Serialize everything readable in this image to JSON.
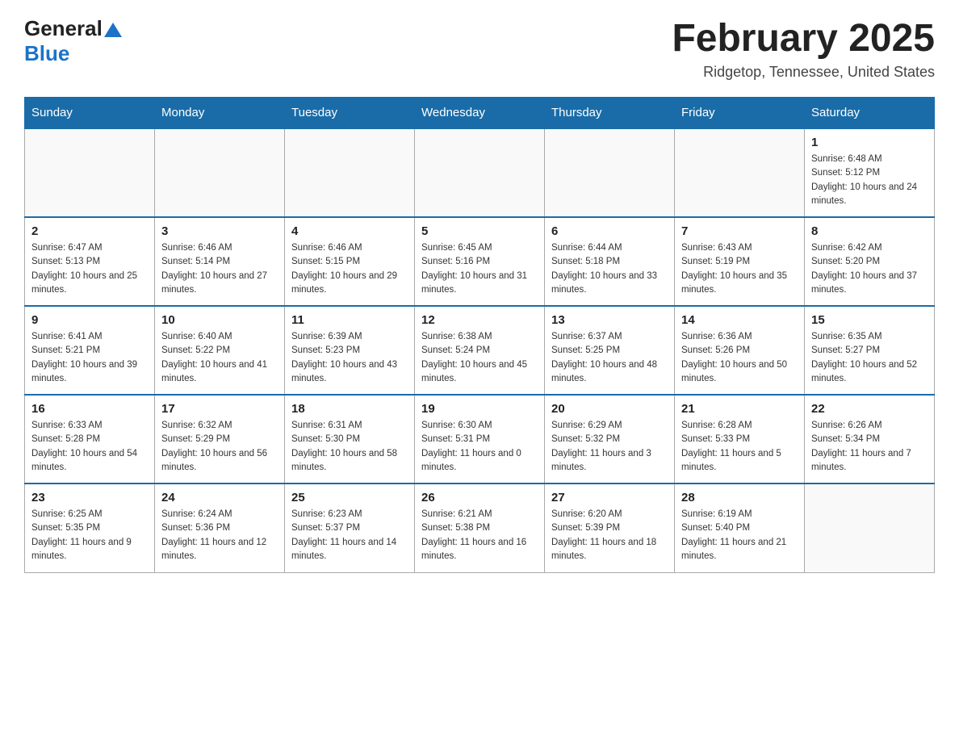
{
  "header": {
    "logo_general": "General",
    "logo_blue": "Blue",
    "title": "February 2025",
    "location": "Ridgetop, Tennessee, United States"
  },
  "weekdays": [
    "Sunday",
    "Monday",
    "Tuesday",
    "Wednesday",
    "Thursday",
    "Friday",
    "Saturday"
  ],
  "weeks": [
    [
      {
        "day": "",
        "info": ""
      },
      {
        "day": "",
        "info": ""
      },
      {
        "day": "",
        "info": ""
      },
      {
        "day": "",
        "info": ""
      },
      {
        "day": "",
        "info": ""
      },
      {
        "day": "",
        "info": ""
      },
      {
        "day": "1",
        "info": "Sunrise: 6:48 AM\nSunset: 5:12 PM\nDaylight: 10 hours and 24 minutes."
      }
    ],
    [
      {
        "day": "2",
        "info": "Sunrise: 6:47 AM\nSunset: 5:13 PM\nDaylight: 10 hours and 25 minutes."
      },
      {
        "day": "3",
        "info": "Sunrise: 6:46 AM\nSunset: 5:14 PM\nDaylight: 10 hours and 27 minutes."
      },
      {
        "day": "4",
        "info": "Sunrise: 6:46 AM\nSunset: 5:15 PM\nDaylight: 10 hours and 29 minutes."
      },
      {
        "day": "5",
        "info": "Sunrise: 6:45 AM\nSunset: 5:16 PM\nDaylight: 10 hours and 31 minutes."
      },
      {
        "day": "6",
        "info": "Sunrise: 6:44 AM\nSunset: 5:18 PM\nDaylight: 10 hours and 33 minutes."
      },
      {
        "day": "7",
        "info": "Sunrise: 6:43 AM\nSunset: 5:19 PM\nDaylight: 10 hours and 35 minutes."
      },
      {
        "day": "8",
        "info": "Sunrise: 6:42 AM\nSunset: 5:20 PM\nDaylight: 10 hours and 37 minutes."
      }
    ],
    [
      {
        "day": "9",
        "info": "Sunrise: 6:41 AM\nSunset: 5:21 PM\nDaylight: 10 hours and 39 minutes."
      },
      {
        "day": "10",
        "info": "Sunrise: 6:40 AM\nSunset: 5:22 PM\nDaylight: 10 hours and 41 minutes."
      },
      {
        "day": "11",
        "info": "Sunrise: 6:39 AM\nSunset: 5:23 PM\nDaylight: 10 hours and 43 minutes."
      },
      {
        "day": "12",
        "info": "Sunrise: 6:38 AM\nSunset: 5:24 PM\nDaylight: 10 hours and 45 minutes."
      },
      {
        "day": "13",
        "info": "Sunrise: 6:37 AM\nSunset: 5:25 PM\nDaylight: 10 hours and 48 minutes."
      },
      {
        "day": "14",
        "info": "Sunrise: 6:36 AM\nSunset: 5:26 PM\nDaylight: 10 hours and 50 minutes."
      },
      {
        "day": "15",
        "info": "Sunrise: 6:35 AM\nSunset: 5:27 PM\nDaylight: 10 hours and 52 minutes."
      }
    ],
    [
      {
        "day": "16",
        "info": "Sunrise: 6:33 AM\nSunset: 5:28 PM\nDaylight: 10 hours and 54 minutes."
      },
      {
        "day": "17",
        "info": "Sunrise: 6:32 AM\nSunset: 5:29 PM\nDaylight: 10 hours and 56 minutes."
      },
      {
        "day": "18",
        "info": "Sunrise: 6:31 AM\nSunset: 5:30 PM\nDaylight: 10 hours and 58 minutes."
      },
      {
        "day": "19",
        "info": "Sunrise: 6:30 AM\nSunset: 5:31 PM\nDaylight: 11 hours and 0 minutes."
      },
      {
        "day": "20",
        "info": "Sunrise: 6:29 AM\nSunset: 5:32 PM\nDaylight: 11 hours and 3 minutes."
      },
      {
        "day": "21",
        "info": "Sunrise: 6:28 AM\nSunset: 5:33 PM\nDaylight: 11 hours and 5 minutes."
      },
      {
        "day": "22",
        "info": "Sunrise: 6:26 AM\nSunset: 5:34 PM\nDaylight: 11 hours and 7 minutes."
      }
    ],
    [
      {
        "day": "23",
        "info": "Sunrise: 6:25 AM\nSunset: 5:35 PM\nDaylight: 11 hours and 9 minutes."
      },
      {
        "day": "24",
        "info": "Sunrise: 6:24 AM\nSunset: 5:36 PM\nDaylight: 11 hours and 12 minutes."
      },
      {
        "day": "25",
        "info": "Sunrise: 6:23 AM\nSunset: 5:37 PM\nDaylight: 11 hours and 14 minutes."
      },
      {
        "day": "26",
        "info": "Sunrise: 6:21 AM\nSunset: 5:38 PM\nDaylight: 11 hours and 16 minutes."
      },
      {
        "day": "27",
        "info": "Sunrise: 6:20 AM\nSunset: 5:39 PM\nDaylight: 11 hours and 18 minutes."
      },
      {
        "day": "28",
        "info": "Sunrise: 6:19 AM\nSunset: 5:40 PM\nDaylight: 11 hours and 21 minutes."
      },
      {
        "day": "",
        "info": ""
      }
    ]
  ]
}
